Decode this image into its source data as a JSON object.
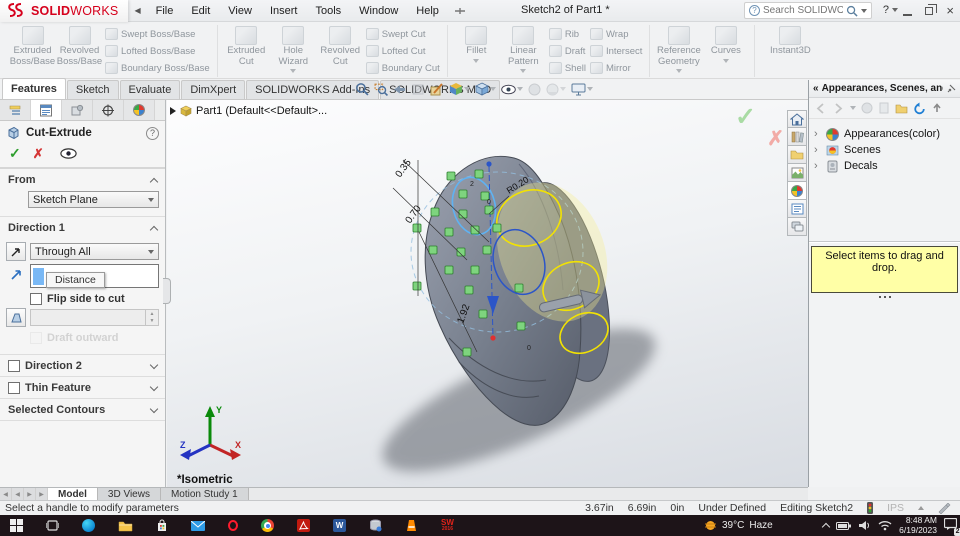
{
  "glyphs": {
    "check": "✓",
    "cross": "✗",
    "laquo": "«",
    "tri_left": "◀",
    "tri_right": "▶",
    "q_mark": "?",
    "close_x": "×",
    "expander": "›"
  },
  "window": {
    "title": "Sketch2 of Part1 *",
    "search_placeholder": "Search SOLIDWORKS Help",
    "brand_bold": "SOLID",
    "brand_light": "WORKS"
  },
  "menubar": {
    "items": [
      "File",
      "Edit",
      "View",
      "Insert",
      "Tools",
      "Window",
      "Help"
    ]
  },
  "ribbon": {
    "features_group": [
      "Extruded Boss/Base",
      "Revolved Boss/Base",
      "Swept Boss/Base",
      "Lofted Boss/Base",
      "Boundary Boss/Base"
    ],
    "cut_group": [
      "Extruded Cut",
      "Hole Wizard",
      "Revolved Cut",
      "Swept Cut",
      "Lofted Cut",
      "Boundary Cut"
    ],
    "modify_group": [
      "Fillet",
      "Linear Pattern",
      "Rib",
      "Draft",
      "Shell",
      "Wrap",
      "Intersect",
      "Mirror"
    ],
    "reference_group": [
      "Reference Geometry",
      "Curves"
    ],
    "instant_group": [
      "Instant3D"
    ]
  },
  "tabs": {
    "items": [
      "Features",
      "Sketch",
      "Evaluate",
      "DimXpert",
      "SOLIDWORKS Add-Ins",
      "SOLIDWORKS MBD"
    ],
    "active": "Features"
  },
  "pm": {
    "title": "Cut-Extrude",
    "from_label": "From",
    "from_value": "Sketch Plane",
    "dir1_label": "Direction 1",
    "dir1_value": "Through All",
    "distance_tooltip": "Distance",
    "flip_label": "Flip side to cut",
    "draft_outward_label": "Draft outward",
    "dir2_label": "Direction 2",
    "thin_label": "Thin Feature",
    "contours_label": "Selected Contours"
  },
  "graphics": {
    "breadcrumb": "Part1 (Default<<Default>...",
    "view_label": "*Isometric",
    "dims": {
      "d1": "0.35",
      "d2": "0.70",
      "d3": "1.92",
      "r1": "R0.20"
    },
    "badges": [
      "2",
      "0",
      "0"
    ],
    "axis": {
      "x": "X",
      "y": "Y",
      "z": "Z"
    }
  },
  "task_pane": {
    "header": "Appearances, Scenes, and Decals",
    "items": [
      "Appearances(color)",
      "Scenes",
      "Decals"
    ],
    "hint": "Select items to drag and drop."
  },
  "bottom_tabs": {
    "items": [
      "Model",
      "3D Views",
      "Motion Study 1"
    ],
    "active": "Model"
  },
  "status_bar": {
    "message": "Select a handle to modify parameters",
    "x": "3.67in",
    "y": "6.69in",
    "z": "0in",
    "state": "Under Defined",
    "mode": "Editing Sketch2",
    "units": "IPS"
  },
  "taskbar": {
    "weather_temp": "39°C",
    "weather_cond": "Haze",
    "time": "8:48 AM",
    "date": "6/19/2023",
    "notification_count": "2",
    "word_letter": "W",
    "sw_letters": "SW",
    "sw_year": "2016"
  },
  "colors": {
    "accent_red": "#d6001c",
    "selection_blue": "#79b8f5",
    "hint_yellow": "#ffffa6"
  }
}
